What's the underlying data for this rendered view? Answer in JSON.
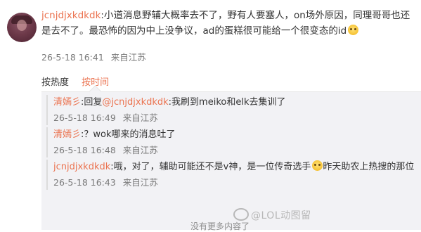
{
  "main_comment": {
    "username": "jcnjdjxkdkdk",
    "separator": ":",
    "text": "小道消息野辅大概率去不了，野有人要塞人，on场外原因，同理哥哥也还是去不了。最恐怖的因为中上没争议，ad的蛋糕很可能给一个很变态的id",
    "emoji": "smile-emoji",
    "timestamp": "26-5-18 16:41",
    "source": "来自江苏"
  },
  "sort": {
    "hot_label": "按热度",
    "time_label": "按时间"
  },
  "replies": [
    {
      "username": "清嫣彡",
      "prefix": ":回复",
      "mention": "@jcnjdjxkdkdk",
      "text": ":我刷到meiko和elk去集训了",
      "timestamp": "26-5-18 16:49",
      "source": "来自江苏"
    },
    {
      "username": "清嫣彡",
      "text": ":？wok哪来的消息吐了",
      "timestamp": "26-5-18 16:48",
      "source": "来自江苏"
    },
    {
      "username": "jcnjdjxkdkdk",
      "text_a": ":哦，对了，辅助可能还不是v神，是一位传奇选手",
      "emoji": "smile-emoji",
      "text_b": "昨天助农上热搜的那位",
      "timestamp": "26-5-18 16:43",
      "source": "来自江苏"
    }
  ],
  "watermark": {
    "text": "@LOL动图留"
  },
  "footer": {
    "hint": "没有更多内容了"
  },
  "colors": {
    "accent": "#eb7350",
    "text": "#333333",
    "meta": "#7a7a7a",
    "panel_bg": "#f2f2f5"
  }
}
